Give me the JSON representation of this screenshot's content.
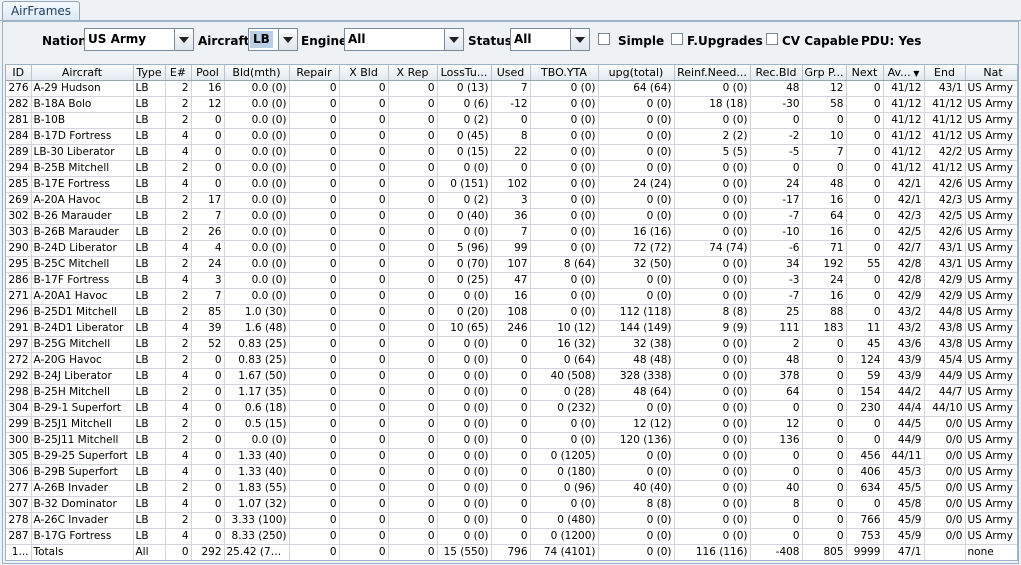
{
  "tab": {
    "label": "AirFrames"
  },
  "filters": {
    "nation_label": "Nation:",
    "nation_value": "US Army",
    "aircraft_label": "Aircraft:",
    "aircraft_value": "LB",
    "engine_label": "Engine:",
    "engine_value": "All",
    "status_label": "Status:",
    "status_value": "All",
    "simple_label": "Simple",
    "fupgrades_label": "F.Upgrades",
    "cvcapable_label": "CV Capable",
    "pdu_text": "PDU: Yes"
  },
  "table": {
    "columns": [
      "ID",
      "Aircraft",
      "Type",
      "E#",
      "Pool",
      "Bld(mth)",
      "Repair",
      "X Bld",
      "X Rep",
      "LossTu...",
      "Used",
      "TBO.YTA",
      "upg(total)",
      "Reinf.Need...",
      "Rec.Bld",
      "Grp P...",
      "Next",
      "Av...",
      "End",
      "Nat"
    ],
    "rows": [
      [
        "276",
        "A-29 Hudson",
        "LB",
        "2",
        "16",
        "0.0 (0)",
        "0",
        "0",
        "0",
        "0 (13)",
        "7",
        "0 (0)",
        "64 (64)",
        "0 (0)",
        "48",
        "12",
        "0",
        "41/12",
        "43/1",
        "US Army"
      ],
      [
        "282",
        "B-18A Bolo",
        "LB",
        "2",
        "12",
        "0.0 (0)",
        "0",
        "0",
        "0",
        "0 (6)",
        "-12",
        "0 (0)",
        "0 (0)",
        "18 (18)",
        "-30",
        "58",
        "0",
        "41/12",
        "41/12",
        "US Army"
      ],
      [
        "281",
        "B-10B",
        "LB",
        "2",
        "0",
        "0.0 (0)",
        "0",
        "0",
        "0",
        "0 (2)",
        "0",
        "0 (0)",
        "0 (0)",
        "0 (0)",
        "0",
        "0",
        "0",
        "41/12",
        "41/12",
        "US Army"
      ],
      [
        "284",
        "B-17D Fortress",
        "LB",
        "4",
        "0",
        "0.0 (0)",
        "0",
        "0",
        "0",
        "0 (45)",
        "8",
        "0 (0)",
        "0 (0)",
        "2 (2)",
        "-2",
        "10",
        "0",
        "41/12",
        "41/12",
        "US Army"
      ],
      [
        "289",
        "LB-30 Liberator",
        "LB",
        "4",
        "0",
        "0.0 (0)",
        "0",
        "0",
        "0",
        "0 (15)",
        "22",
        "0 (0)",
        "0 (0)",
        "5 (5)",
        "-5",
        "7",
        "0",
        "41/12",
        "42/2",
        "US Army"
      ],
      [
        "294",
        "B-25B Mitchell",
        "LB",
        "2",
        "0",
        "0.0 (0)",
        "0",
        "0",
        "0",
        "0 (0)",
        "0",
        "0 (0)",
        "0 (0)",
        "0 (0)",
        "0",
        "0",
        "0",
        "41/12",
        "41/12",
        "US Army"
      ],
      [
        "285",
        "B-17E Fortress",
        "LB",
        "4",
        "0",
        "0.0 (0)",
        "0",
        "0",
        "0",
        "0 (151)",
        "102",
        "0 (0)",
        "24 (24)",
        "0 (0)",
        "24",
        "48",
        "0",
        "42/1",
        "42/6",
        "US Army"
      ],
      [
        "269",
        "A-20A Havoc",
        "LB",
        "2",
        "17",
        "0.0 (0)",
        "0",
        "0",
        "0",
        "0 (2)",
        "3",
        "0 (0)",
        "0 (0)",
        "0 (0)",
        "-17",
        "16",
        "0",
        "42/1",
        "42/3",
        "US Army"
      ],
      [
        "302",
        "B-26 Marauder",
        "LB",
        "2",
        "7",
        "0.0 (0)",
        "0",
        "0",
        "0",
        "0 (40)",
        "36",
        "0 (0)",
        "0 (0)",
        "0 (0)",
        "-7",
        "64",
        "0",
        "42/3",
        "42/5",
        "US Army"
      ],
      [
        "303",
        "B-26B Marauder",
        "LB",
        "2",
        "26",
        "0.0 (0)",
        "0",
        "0",
        "0",
        "0 (0)",
        "7",
        "0 (0)",
        "16 (16)",
        "0 (0)",
        "-10",
        "16",
        "0",
        "42/5",
        "42/6",
        "US Army"
      ],
      [
        "290",
        "B-24D Liberator",
        "LB",
        "4",
        "4",
        "0.0 (0)",
        "0",
        "0",
        "0",
        "5 (96)",
        "99",
        "0 (0)",
        "72 (72)",
        "74 (74)",
        "-6",
        "71",
        "0",
        "42/7",
        "43/1",
        "US Army"
      ],
      [
        "295",
        "B-25C Mitchell",
        "LB",
        "2",
        "24",
        "0.0 (0)",
        "0",
        "0",
        "0",
        "0 (70)",
        "107",
        "8 (64)",
        "32 (50)",
        "0 (0)",
        "34",
        "192",
        "55",
        "42/8",
        "43/1",
        "US Army"
      ],
      [
        "286",
        "B-17F Fortress",
        "LB",
        "4",
        "3",
        "0.0 (0)",
        "0",
        "0",
        "0",
        "0 (25)",
        "47",
        "0 (0)",
        "0 (0)",
        "0 (0)",
        "-3",
        "24",
        "0",
        "42/8",
        "42/9",
        "US Army"
      ],
      [
        "271",
        "A-20A1 Havoc",
        "LB",
        "2",
        "7",
        "0.0 (0)",
        "0",
        "0",
        "0",
        "0 (0)",
        "16",
        "0 (0)",
        "0 (0)",
        "0 (0)",
        "-7",
        "16",
        "0",
        "42/9",
        "42/9",
        "US Army"
      ],
      [
        "296",
        "B-25D1 Mitchell",
        "LB",
        "2",
        "85",
        "1.0 (30)",
        "0",
        "0",
        "0",
        "0 (20)",
        "108",
        "0 (0)",
        "112 (118)",
        "8 (8)",
        "25",
        "88",
        "0",
        "43/2",
        "44/8",
        "US Army"
      ],
      [
        "291",
        "B-24D1 Liberator",
        "LB",
        "4",
        "39",
        "1.6 (48)",
        "0",
        "0",
        "0",
        "10 (65)",
        "246",
        "10 (12)",
        "144 (149)",
        "9 (9)",
        "111",
        "183",
        "11",
        "43/2",
        "43/8",
        "US Army"
      ],
      [
        "297",
        "B-25G Mitchell",
        "LB",
        "2",
        "52",
        "0.83 (25)",
        "0",
        "0",
        "0",
        "0 (0)",
        "0",
        "16 (32)",
        "32 (38)",
        "0 (0)",
        "2",
        "0",
        "45",
        "43/6",
        "43/8",
        "US Army"
      ],
      [
        "272",
        "A-20G Havoc",
        "LB",
        "2",
        "0",
        "0.83 (25)",
        "0",
        "0",
        "0",
        "0 (0)",
        "0",
        "0 (64)",
        "48 (48)",
        "0 (0)",
        "48",
        "0",
        "124",
        "43/9",
        "45/4",
        "US Army"
      ],
      [
        "292",
        "B-24J Liberator",
        "LB",
        "4",
        "0",
        "1.67 (50)",
        "0",
        "0",
        "0",
        "0 (0)",
        "0",
        "40 (508)",
        "328 (338)",
        "0 (0)",
        "378",
        "0",
        "59",
        "43/9",
        "44/9",
        "US Army"
      ],
      [
        "298",
        "B-25H Mitchell",
        "LB",
        "2",
        "0",
        "1.17 (35)",
        "0",
        "0",
        "0",
        "0 (0)",
        "0",
        "0 (28)",
        "48 (64)",
        "0 (0)",
        "64",
        "0",
        "154",
        "44/2",
        "44/7",
        "US Army"
      ],
      [
        "304",
        "B-29-1 Superfort",
        "LB",
        "4",
        "0",
        "0.6 (18)",
        "0",
        "0",
        "0",
        "0 (0)",
        "0",
        "0 (232)",
        "0 (0)",
        "0 (0)",
        "0",
        "0",
        "230",
        "44/4",
        "44/10",
        "US Army"
      ],
      [
        "299",
        "B-25J1 Mitchell",
        "LB",
        "2",
        "0",
        "0.5 (15)",
        "0",
        "0",
        "0",
        "0 (0)",
        "0",
        "0 (0)",
        "12 (12)",
        "0 (0)",
        "12",
        "0",
        "0",
        "44/5",
        "0/0",
        "US Army"
      ],
      [
        "300",
        "B-25J11 Mitchell",
        "LB",
        "2",
        "0",
        "0.0 (0)",
        "0",
        "0",
        "0",
        "0 (0)",
        "0",
        "0 (0)",
        "120 (136)",
        "0 (0)",
        "136",
        "0",
        "0",
        "44/9",
        "0/0",
        "US Army"
      ],
      [
        "305",
        "B-29-25 Superfort",
        "LB",
        "4",
        "0",
        "1.33 (40)",
        "0",
        "0",
        "0",
        "0 (0)",
        "0",
        "0 (1205)",
        "0 (0)",
        "0 (0)",
        "0",
        "0",
        "456",
        "44/11",
        "0/0",
        "US Army"
      ],
      [
        "306",
        "B-29B Superfort",
        "LB",
        "4",
        "0",
        "1.33 (40)",
        "0",
        "0",
        "0",
        "0 (0)",
        "0",
        "0 (180)",
        "0 (0)",
        "0 (0)",
        "0",
        "0",
        "406",
        "45/3",
        "0/0",
        "US Army"
      ],
      [
        "277",
        "A-26B Invader",
        "LB",
        "2",
        "0",
        "1.83 (55)",
        "0",
        "0",
        "0",
        "0 (0)",
        "0",
        "0 (96)",
        "40 (40)",
        "0 (0)",
        "40",
        "0",
        "634",
        "45/5",
        "0/0",
        "US Army"
      ],
      [
        "307",
        "B-32 Dominator",
        "LB",
        "4",
        "0",
        "1.07 (32)",
        "0",
        "0",
        "0",
        "0 (0)",
        "0",
        "0 (0)",
        "8 (8)",
        "0 (0)",
        "8",
        "0",
        "0",
        "45/8",
        "0/0",
        "US Army"
      ],
      [
        "278",
        "A-26C Invader",
        "LB",
        "2",
        "0",
        "3.33 (100)",
        "0",
        "0",
        "0",
        "0 (0)",
        "0",
        "0 (480)",
        "0 (0)",
        "0 (0)",
        "0",
        "0",
        "766",
        "45/9",
        "0/0",
        "US Army"
      ],
      [
        "287",
        "B-17G Fortress",
        "LB",
        "4",
        "0",
        "8.33 (250)",
        "0",
        "0",
        "0",
        "0 (0)",
        "0",
        "0 (1200)",
        "0 (0)",
        "0 (0)",
        "0",
        "0",
        "753",
        "45/9",
        "0/0",
        "US Army"
      ],
      [
        "1...",
        "Totals",
        "All",
        "0",
        "292",
        "25.42 (763)",
        "0",
        "0",
        "0",
        "15 (550)",
        "796",
        "74 (4101)",
        "0 (0)",
        "116 (116)",
        "-408",
        "805",
        "9999",
        "47/1",
        "",
        "none"
      ]
    ]
  },
  "colors": {
    "accent": "#1f3f63",
    "header_bg": "#e3e9ef",
    "panel_bg": "#eef2f5"
  },
  "icons": {
    "sort": "sort-descending-icon",
    "dropdown": "chevron-down-icon"
  }
}
